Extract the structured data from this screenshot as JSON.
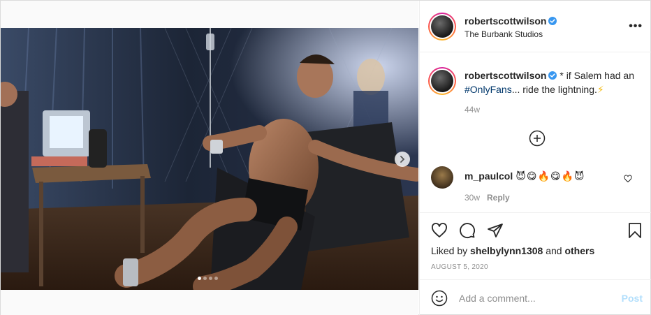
{
  "post": {
    "author": {
      "username": "robertscottwilson",
      "verified": true,
      "location": "The Burbank Studios",
      "avatar": "profile-photo"
    },
    "media": {
      "description_icon": "photo",
      "carousel_count": 4,
      "carousel_active": 1,
      "next_icon": "chevron-right-icon"
    },
    "more_label": "•••",
    "caption": {
      "username": "robertscottwilson",
      "text_before": "* if Salem had an",
      "hashtag": "#OnlyFans",
      "text_after": "... ride the lightning.",
      "emoji": "⚡",
      "age": "44w"
    },
    "load_more_icon": "plus-circle-icon",
    "comments": [
      {
        "username": "m_paulcol",
        "text": "😈😋🔥😋🔥😈",
        "age": "30w",
        "reply_label": "Reply"
      }
    ],
    "actions": {
      "like_icon": "heart-icon",
      "comment_icon": "comment-icon",
      "share_icon": "paper-plane-icon",
      "save_icon": "bookmark-icon"
    },
    "likes": {
      "prefix": "Liked by",
      "user": "shelbylynn1308",
      "joiner": "and",
      "others": "others"
    },
    "date": "AUGUST 5, 2020",
    "add_comment": {
      "placeholder": "Add a comment...",
      "post_label": "Post",
      "emoji_icon": "smiley-icon"
    }
  },
  "colors": {
    "link": "#00376b",
    "muted": "#8e8e8e",
    "post_disabled": "#b2dffc",
    "verified": "#3897f0",
    "border": "#efefef"
  }
}
